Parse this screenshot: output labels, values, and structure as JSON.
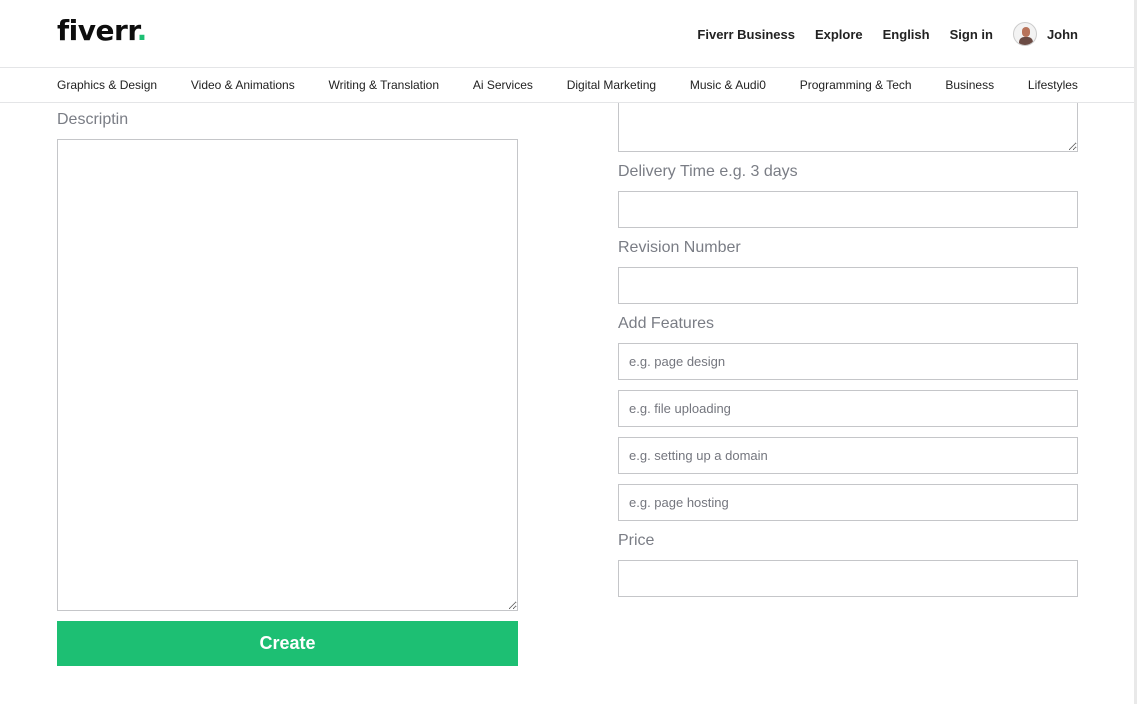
{
  "brand": {
    "name": "fiverr",
    "dot": ".",
    "accent": "#1dbf73"
  },
  "topnav": {
    "business": "Fiverr Business",
    "explore": "Explore",
    "language": "English",
    "signin": "Sign in",
    "username": "John"
  },
  "categories": [
    "Graphics & Design",
    "Video & Animations",
    "Writing & Translation",
    "Ai Services",
    "Digital Marketing",
    "Music & Audi0",
    "Programming & Tech",
    "Business",
    "Lifestyles"
  ],
  "form": {
    "description_label": "Descriptin",
    "delivery_label": "Delivery Time e.g. 3 days",
    "revision_label": "Revision Number",
    "features_label": "Add Features",
    "features": [
      {
        "placeholder": "e.g. page design"
      },
      {
        "placeholder": "e.g. file uploading"
      },
      {
        "placeholder": "e.g. setting up a domain"
      },
      {
        "placeholder": "e.g. page hosting"
      }
    ],
    "price_label": "Price",
    "create_label": "Create"
  }
}
